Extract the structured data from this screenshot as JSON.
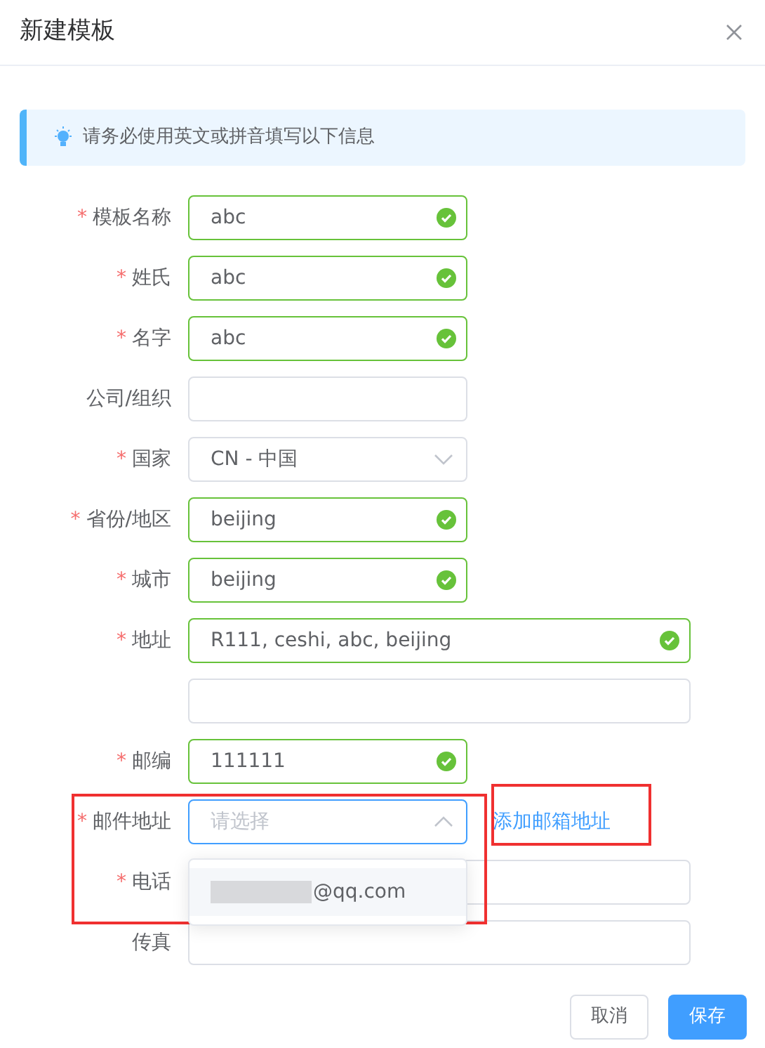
{
  "dialog": {
    "title": "新建模板"
  },
  "alert": {
    "text": "请务必使用英文或拼音填写以下信息"
  },
  "required_mark": "*",
  "fields": [
    {
      "label": "模板名称",
      "required": true,
      "kind": "text",
      "value": "abc",
      "valid": true
    },
    {
      "label": "姓氏",
      "required": true,
      "kind": "text",
      "value": "abc",
      "valid": true
    },
    {
      "label": "名字",
      "required": true,
      "kind": "text",
      "value": "abc",
      "valid": true
    },
    {
      "label": "公司/组织",
      "required": false,
      "kind": "text",
      "valid": false
    },
    {
      "label": "国家",
      "required": true,
      "kind": "select",
      "value": "CN - 中国",
      "expanded": false
    },
    {
      "label": "省份/地区",
      "required": true,
      "kind": "text",
      "value": "beijing",
      "valid": true
    },
    {
      "label": "城市",
      "required": true,
      "kind": "text",
      "value": "beijing",
      "valid": true
    },
    {
      "label": "地址",
      "required": true,
      "kind": "long-text",
      "value": "R111, ceshi, abc, beijing",
      "valid": true
    },
    {
      "kind": "long-text",
      "valid": false
    },
    {
      "label": "邮编",
      "required": true,
      "kind": "text",
      "value": "111111",
      "valid": true
    },
    {
      "label": "邮件地址",
      "required": true,
      "kind": "select",
      "placeholder": "请选择",
      "expanded": true,
      "link": "添加邮箱地址",
      "options": [
        {
          "text": "@qq.com",
          "redacted": true
        }
      ]
    },
    {
      "label": "电话",
      "required": true,
      "kind": "long-text",
      "valid": false
    },
    {
      "label": "传真",
      "required": false,
      "kind": "long-text",
      "valid": false
    }
  ],
  "buttons": [
    {
      "label": "取消",
      "kind": "secondary"
    },
    {
      "label": "保存",
      "kind": "primary"
    }
  ]
}
